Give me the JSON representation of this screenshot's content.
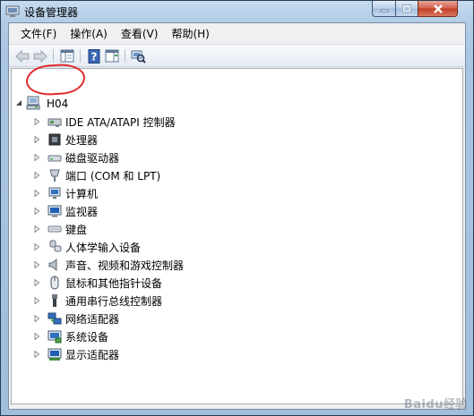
{
  "window": {
    "title": "设备管理器"
  },
  "menu": [
    {
      "label": "文件(F)"
    },
    {
      "label": "操作(A)"
    },
    {
      "label": "查看(V)"
    },
    {
      "label": "帮助(H)"
    }
  ],
  "tree": {
    "root": {
      "label": "H04"
    },
    "items": [
      {
        "label": "IDE ATA/ATAPI 控制器",
        "icon": "ide-controller-icon"
      },
      {
        "label": "处理器",
        "icon": "processor-icon"
      },
      {
        "label": "磁盘驱动器",
        "icon": "disk-drive-icon"
      },
      {
        "label": "端口 (COM 和 LPT)",
        "icon": "port-icon"
      },
      {
        "label": "计算机",
        "icon": "computer-icon"
      },
      {
        "label": "监视器",
        "icon": "monitor-icon"
      },
      {
        "label": "键盘",
        "icon": "keyboard-icon"
      },
      {
        "label": "人体学输入设备",
        "icon": "hid-icon"
      },
      {
        "label": "声音、视频和游戏控制器",
        "icon": "sound-icon"
      },
      {
        "label": "鼠标和其他指针设备",
        "icon": "mouse-icon"
      },
      {
        "label": "通用串行总线控制器",
        "icon": "usb-icon"
      },
      {
        "label": "网络适配器",
        "icon": "network-adapter-icon"
      },
      {
        "label": "系统设备",
        "icon": "system-device-icon"
      },
      {
        "label": "显示适配器",
        "icon": "display-adapter-icon"
      }
    ]
  },
  "watermark": {
    "text": "Baidu经验"
  },
  "colors": {
    "annotation": "#e02a2a",
    "title_gradient_top": "#c6dbef",
    "close_button": "#c23a22"
  }
}
